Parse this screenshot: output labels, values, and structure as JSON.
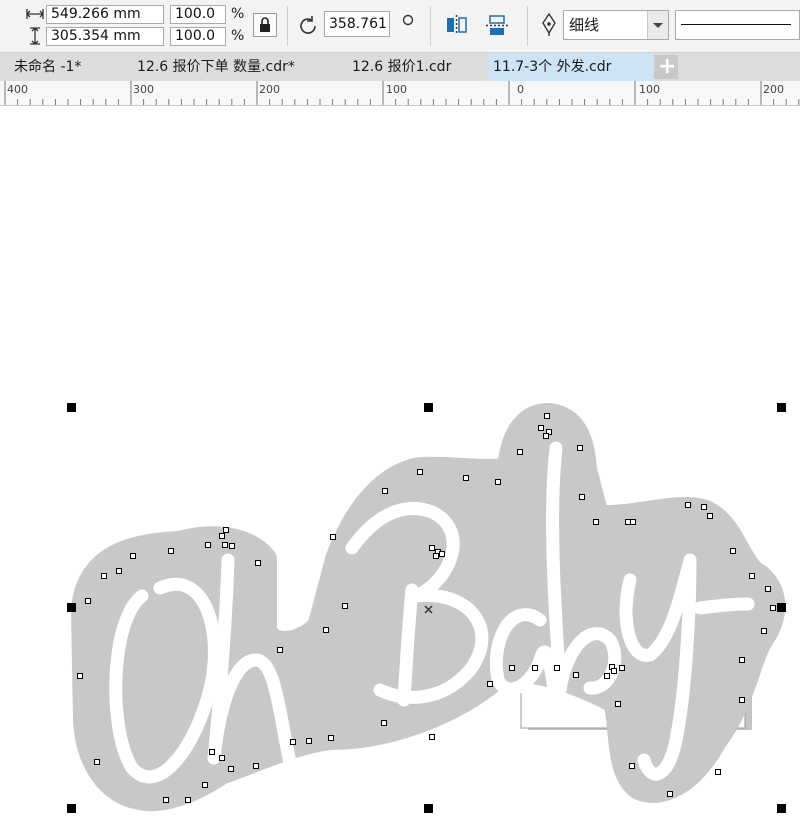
{
  "propbar": {
    "width_value": "549.266 mm",
    "height_value": "305.354 mm",
    "scale_x": "100.0",
    "scale_y": "100.0",
    "percent_x": "%",
    "percent_y": "%",
    "rotation": "358.761",
    "outline_width": "细线"
  },
  "tabs": [
    {
      "label": "未命名 -1*"
    },
    {
      "label": "12.6 报价下单  数量.cdr*"
    },
    {
      "label": "12.6 报价1.cdr"
    },
    {
      "label": "11.7-3个 外发.cdr"
    }
  ],
  "tab_add": "+",
  "ruler": {
    "labels": [
      "400",
      "300",
      "200",
      "100",
      "0",
      "100",
      "200"
    ]
  },
  "artwork": {
    "text": "Oh Baby",
    "fill_color": "#c8c8c8",
    "stroke_color": "#ffffff"
  }
}
